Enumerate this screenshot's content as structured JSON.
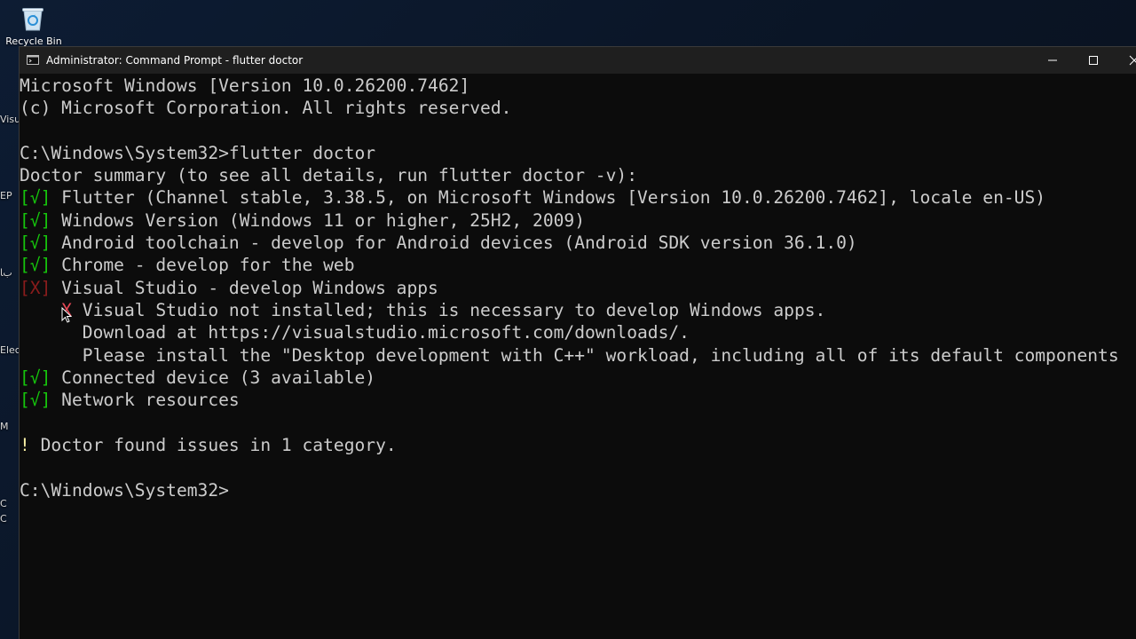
{
  "desktop": {
    "recycle_bin_label": "Recycle Bin",
    "edge_labels": [
      "Visu",
      "EP",
      "ﺏﺎ",
      "Elec",
      "M",
      "C",
      "C"
    ]
  },
  "window": {
    "title": "Administrator: Command Prompt - flutter  doctor"
  },
  "console": {
    "lines": [
      {
        "prefix": "",
        "text": "Microsoft Windows [Version 10.0.26200.7462]"
      },
      {
        "prefix": "",
        "text": "(c) Microsoft Corporation. All rights reserved."
      },
      {
        "prefix": "",
        "text": ""
      },
      {
        "prefix": "",
        "text": "C:\\Windows\\System32>flutter doctor"
      },
      {
        "prefix": "",
        "text": "Doctor summary (to see all details, run flutter doctor -v):"
      },
      {
        "prefix": "[√]",
        "text": " Flutter (Channel stable, 3.38.5, on Microsoft Windows [Version 10.0.26200.7462], locale en-US)"
      },
      {
        "prefix": "[√]",
        "text": " Windows Version (Windows 11 or higher, 25H2, 2009)"
      },
      {
        "prefix": "[√]",
        "text": " Android toolchain - develop for Android devices (Android SDK version 36.1.0)"
      },
      {
        "prefix": "[√]",
        "text": " Chrome - develop for the web"
      },
      {
        "prefix": "[X]",
        "text": " Visual Studio - develop Windows apps"
      },
      {
        "prefix": "    X",
        "text": " Visual Studio not installed; this is necessary to develop Windows apps."
      },
      {
        "prefix": "",
        "text": "      Download at https://visualstudio.microsoft.com/downloads/."
      },
      {
        "prefix": "",
        "text": "      Please install the \"Desktop development with C++\" workload, including all of its default components"
      },
      {
        "prefix": "[√]",
        "text": " Connected device (3 available)"
      },
      {
        "prefix": "[√]",
        "text": " Network resources"
      },
      {
        "prefix": "",
        "text": ""
      },
      {
        "prefix": "!",
        "text": " Doctor found issues in 1 category."
      },
      {
        "prefix": "",
        "text": ""
      },
      {
        "prefix": "",
        "text": "C:\\Windows\\System32>"
      }
    ]
  },
  "colors": {
    "console_bg": "#0c0c0c",
    "console_text": "#cccccc",
    "check_green": "#16c60c",
    "error_red": "#e74856",
    "titlebar_bg": "#1f1f1f"
  }
}
